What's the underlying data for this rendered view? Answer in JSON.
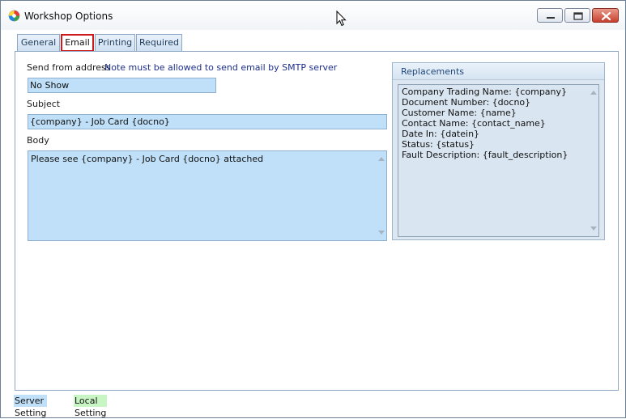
{
  "window": {
    "title": "Workshop Options"
  },
  "tabs": [
    {
      "label": "General",
      "active": false
    },
    {
      "label": "Email",
      "active": true
    },
    {
      "label": "Printing",
      "active": false
    },
    {
      "label": "Required",
      "active": false
    }
  ],
  "email": {
    "send_from_label": "Send from address",
    "note": "Note must be allowed to send email by SMTP server",
    "send_from_value": "No Show",
    "subject_label": "Subject",
    "subject_value": "{company} - Job Card {docno}",
    "body_label": "Body",
    "body_value": "Please see {company} - Job Card {docno} attached"
  },
  "replacements": {
    "title": "Replacements",
    "lines": [
      "Company Trading Name: {company}",
      "Document Number: {docno}",
      "Customer Name: {name}",
      "Contact Name: {contact_name}",
      "Date In: {datein}",
      "Status: {status}",
      "Fault Description: {fault_description}"
    ]
  },
  "footer": {
    "server_setting": "Server Setting",
    "local_setting": "Local Setting"
  },
  "colors": {
    "server_field_bg": "#bfe0f8",
    "local_setting_bg": "#c7f5c3",
    "active_tab_border": "#d0181b",
    "close_button": "#c8402e"
  }
}
